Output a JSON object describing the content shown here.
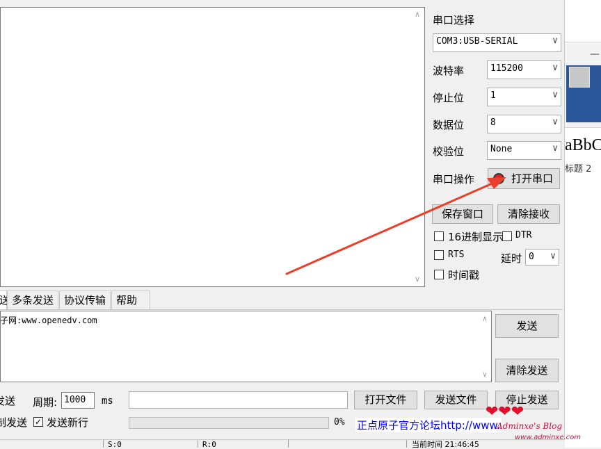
{
  "serial": {
    "port_label": "串口选择",
    "port_value": "COM3:USB-SERIAL",
    "baud_label": "波特率",
    "baud_value": "115200",
    "stop_label": "停止位",
    "stop_value": "1",
    "data_label": "数据位",
    "data_value": "8",
    "parity_label": "校验位",
    "parity_value": "None",
    "op_label": "串口操作",
    "open_button": "打开串口",
    "indicator_color": "#e02020"
  },
  "receive_options": {
    "save_button": "保存窗口",
    "clear_button": "清除接收",
    "hex_display": "16进制显示",
    "dtr": "DTR",
    "rts": "RTS",
    "delay_label": "延时",
    "delay_value": "0",
    "timestamp": "时间戳"
  },
  "tabs": [
    "送",
    "多条发送",
    "协议传输",
    "帮助"
  ],
  "send": {
    "text": "子网:www.openedv.com",
    "send_button": "发送",
    "clear_send_button": "清除发送"
  },
  "bottom": {
    "timed_send": "发送",
    "period_label": "周期:",
    "period_value": "1000",
    "period_unit": "ms",
    "open_file": "打开文件",
    "send_file": "发送文件",
    "stop_send": "停止发送",
    "hex_send": "制发送",
    "newline_label": "发送新行",
    "progress_percent": "0%",
    "progress_value": 0,
    "forum_text": "正点原子官方论坛http://www."
  },
  "status": {
    "seg1": "S:0",
    "seg2": "R:0",
    "time": "当前时间 21:46:45"
  },
  "word": {
    "minimize": "—",
    "style_sample": "aBbC",
    "style_name": "标题 2"
  },
  "watermark": {
    "hearts": "❤❤❤",
    "text": "Adminxe's Blog",
    "url": "www.adminxe.com"
  },
  "colors": {
    "arrow": "#e8402a",
    "link": "#0000ff",
    "word_blue": "#2b579a"
  }
}
